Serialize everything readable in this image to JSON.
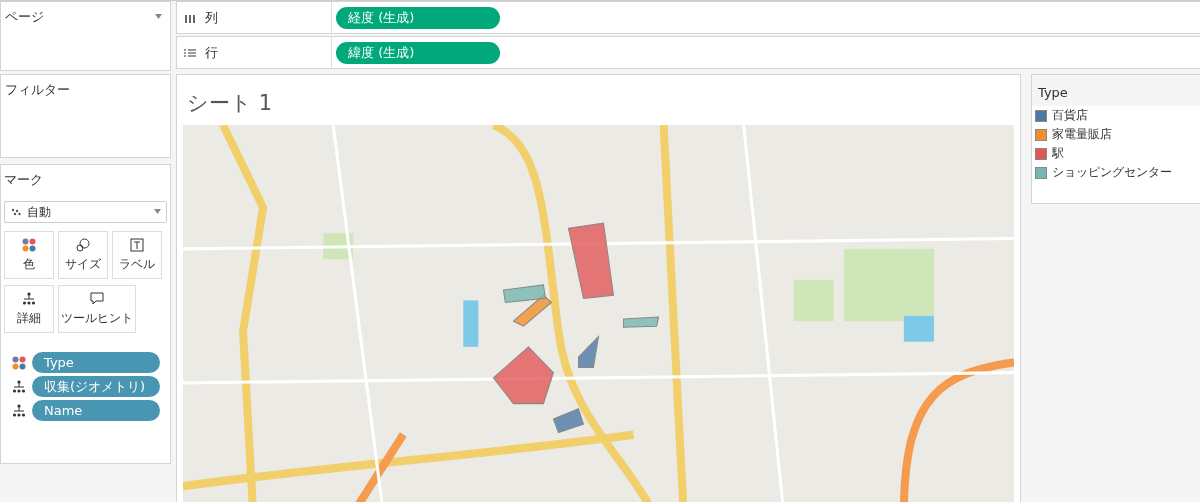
{
  "pages_shelf": {
    "title": "ページ"
  },
  "shelves": [
    {
      "kind": "columns",
      "label": "列",
      "pill": "経度 (生成)"
    },
    {
      "kind": "rows",
      "label": "行",
      "pill": "緯度 (生成)"
    }
  ],
  "filters": {
    "title": "フィルター"
  },
  "marks": {
    "title": "マーク",
    "mark_type": "自動",
    "buttons": [
      {
        "kind": "color",
        "label": "色"
      },
      {
        "kind": "size",
        "label": "サイズ"
      },
      {
        "kind": "label",
        "label": "ラベル"
      },
      {
        "kind": "detail",
        "label": "詳細"
      },
      {
        "kind": "tooltip",
        "label": "ツールヒント"
      }
    ],
    "fields": [
      {
        "kind": "color",
        "label": "Type"
      },
      {
        "kind": "detail",
        "label": "収集(ジオメトリ)"
      },
      {
        "kind": "detail",
        "label": "Name"
      }
    ]
  },
  "sheet": {
    "title": "シート 1"
  },
  "legend": {
    "title": "Type",
    "items": [
      {
        "label": "百貨店",
        "color": "#4e79a7"
      },
      {
        "label": "家電量販店",
        "color": "#f28e2b"
      },
      {
        "label": "駅",
        "color": "#e15759"
      },
      {
        "label": "ショッピングセンター",
        "color": "#76b7b2"
      }
    ]
  }
}
